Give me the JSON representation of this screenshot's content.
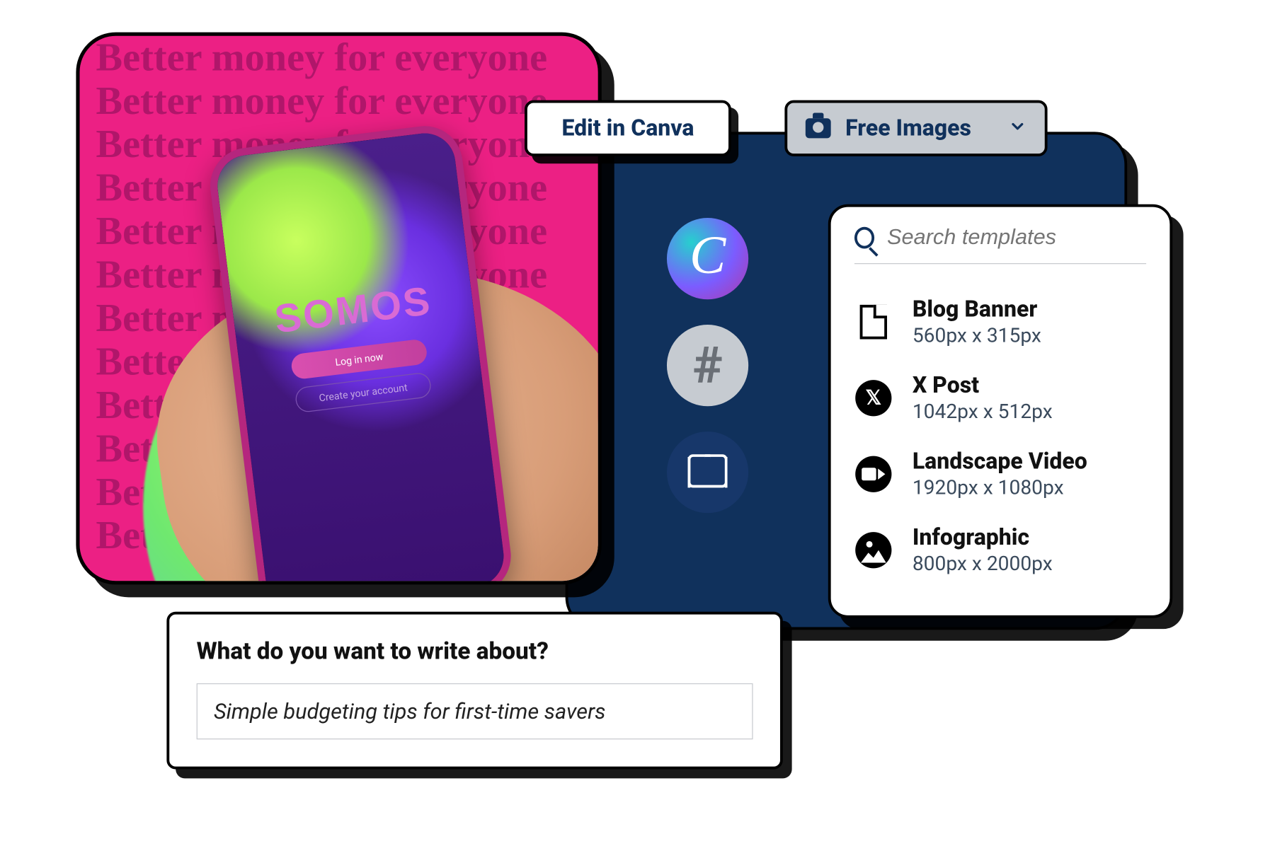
{
  "pinkCard": {
    "repeatedText": "Better money for everyone",
    "phoneBrand": "SOMOS",
    "phoneLoginLabel": "Log in now",
    "phoneCreateLabel": "Create your account"
  },
  "editCanva": {
    "label": "Edit in Canva"
  },
  "freeImages": {
    "label": "Free Images"
  },
  "sideIcons": {
    "canvaGlyph": "C",
    "hashGlyph": "#"
  },
  "templates": {
    "searchPlaceholder": "Search templates",
    "items": [
      {
        "title": "Blog Banner",
        "dim": "560px x 315px",
        "icon": "doc"
      },
      {
        "title": "X Post",
        "dim": "1042px x 512px",
        "icon": "x"
      },
      {
        "title": "Landscape Video",
        "dim": "1920px x 1080px",
        "icon": "vid"
      },
      {
        "title": "Infographic",
        "dim": "800px x 2000px",
        "icon": "img"
      }
    ]
  },
  "writeCard": {
    "title": "What do you want to write about?",
    "value": "Simple budgeting tips for first-time savers"
  }
}
